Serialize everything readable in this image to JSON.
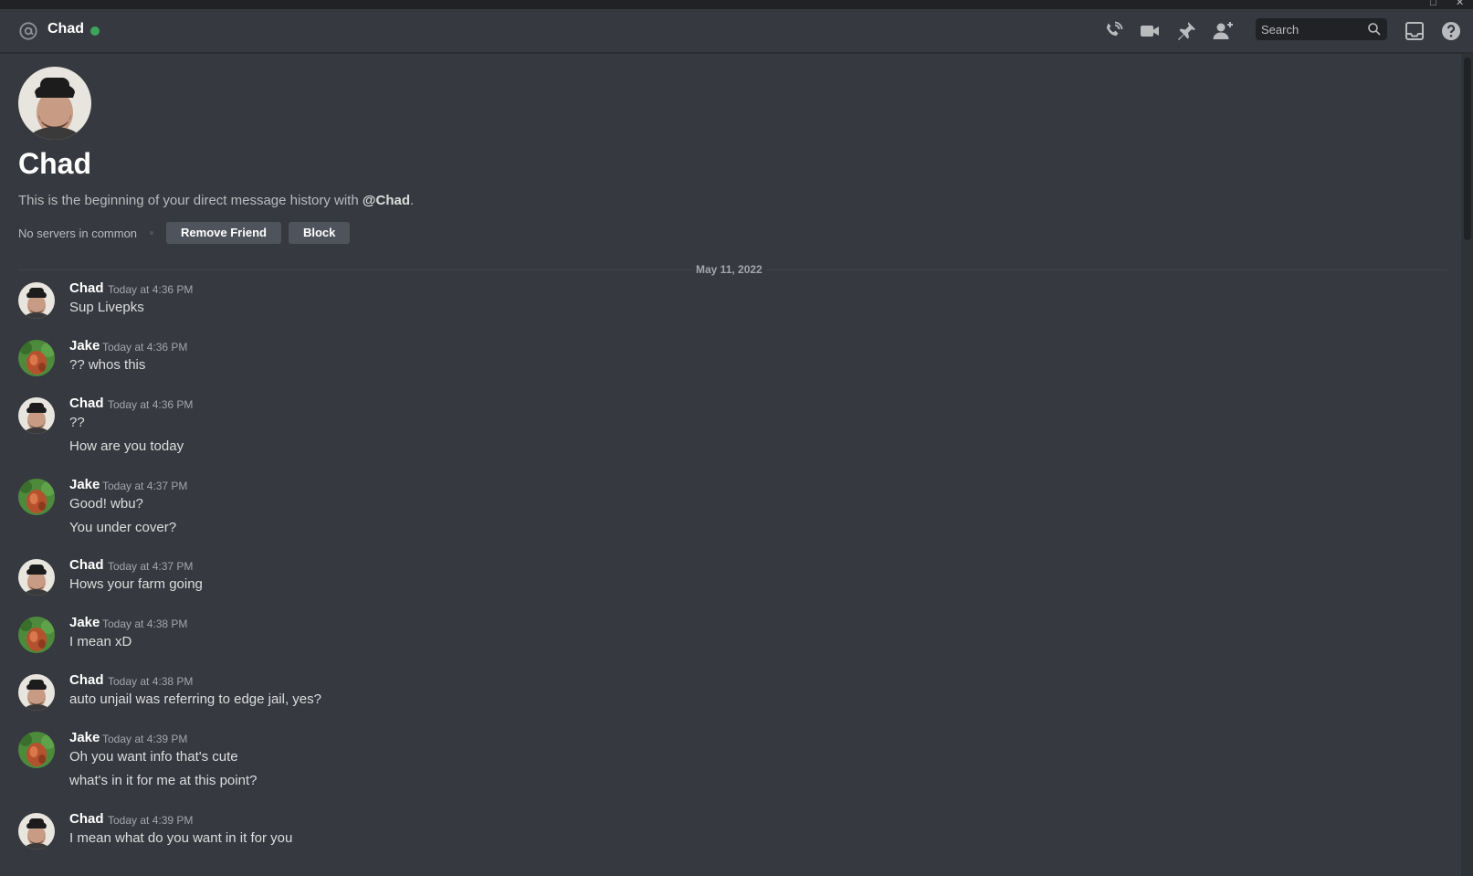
{
  "window": {
    "controls": [
      "□",
      "✕"
    ]
  },
  "header": {
    "title": "Chad",
    "status_color": "#3ba55c",
    "icons": [
      "at-icon",
      "phone-call-icon",
      "video-call-icon",
      "pin-icon",
      "add-friend-icon",
      "inbox-icon",
      "help-icon"
    ],
    "search": {
      "placeholder": "Search"
    }
  },
  "intro": {
    "name": "Chad",
    "desc_prefix": "This is the beginning of your direct message history with ",
    "desc_mention": "@Chad",
    "desc_suffix": ".",
    "servers_text": "No servers in common",
    "remove_friend_label": "Remove Friend",
    "block_label": "Block"
  },
  "divider": {
    "date": "May 11, 2022"
  },
  "messages": [
    {
      "author": "Chad",
      "time": "Today at 4:36 PM",
      "lines": [
        "Sup Livepks"
      ]
    },
    {
      "author": "Jake",
      "time": "Today at 4:36 PM",
      "lines": [
        "?? whos this"
      ]
    },
    {
      "author": "Chad",
      "time": "Today at 4:36 PM",
      "lines": [
        "??",
        "How are you today"
      ]
    },
    {
      "author": "Jake",
      "time": "Today at 4:37 PM",
      "lines": [
        "Good! wbu?",
        "You under cover?"
      ]
    },
    {
      "author": "Chad",
      "time": "Today at 4:37 PM",
      "lines": [
        "Hows your farm going"
      ]
    },
    {
      "author": "Jake",
      "time": "Today at 4:38 PM",
      "lines": [
        "I mean xD"
      ]
    },
    {
      "author": "Chad",
      "time": "Today at 4:38 PM",
      "lines": [
        "auto unjail was referring to edge jail, yes?"
      ]
    },
    {
      "author": "Jake",
      "time": "Today at 4:39 PM",
      "lines": [
        "Oh you want info that's cute",
        "what's in it for me at this point?"
      ]
    },
    {
      "author": "Chad",
      "time": "Today at 4:39 PM",
      "lines": [
        "I mean what do you want in it for you"
      ]
    }
  ]
}
